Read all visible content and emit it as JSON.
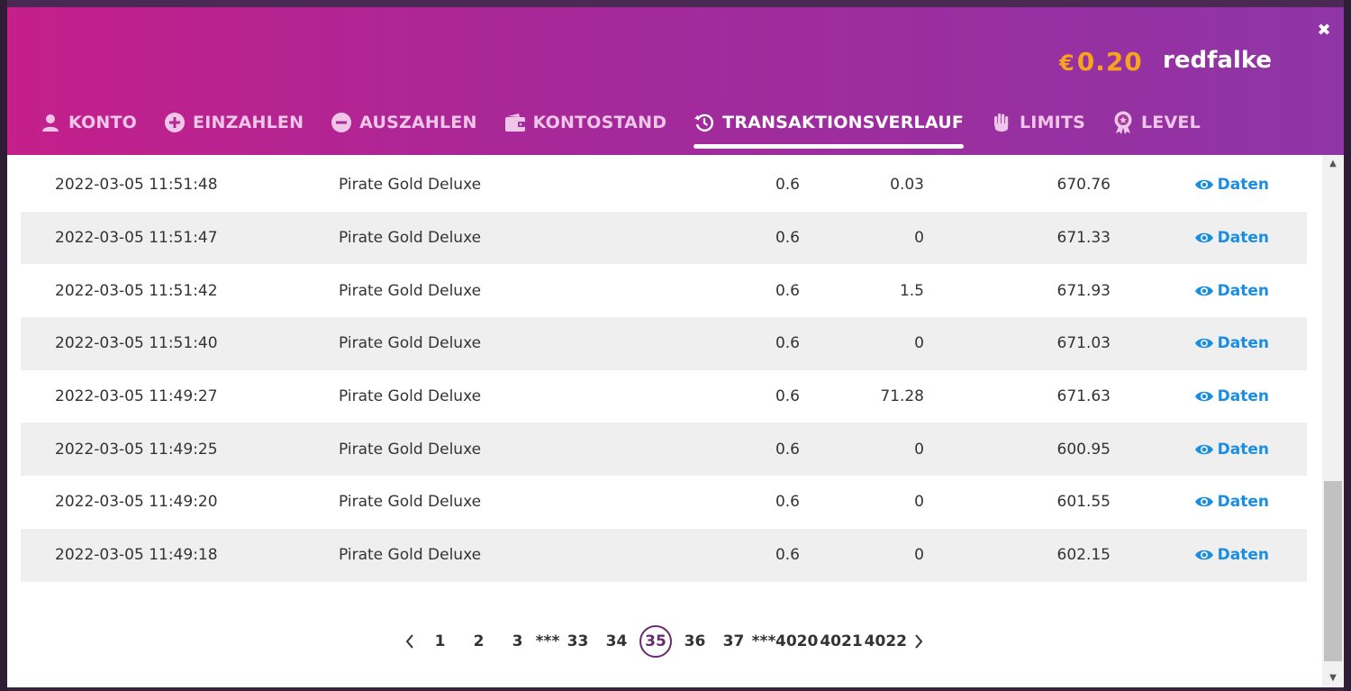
{
  "header": {
    "close_label": "✖",
    "balance_currency": "€",
    "balance_amount": "0.20",
    "username": "redfalke"
  },
  "tabs": [
    {
      "label": "KONTO",
      "icon": "user-icon",
      "active": false
    },
    {
      "label": "EINZAHLEN",
      "icon": "plus-circle-icon",
      "active": false
    },
    {
      "label": "AUSZAHLEN",
      "icon": "minus-circle-icon",
      "active": false
    },
    {
      "label": "KONTOSTAND",
      "icon": "wallet-icon",
      "active": false
    },
    {
      "label": "TRANSAKTIONSVERLAUF",
      "icon": "history-icon",
      "active": true
    },
    {
      "label": "LIMITS",
      "icon": "hand-icon",
      "active": false
    },
    {
      "label": "LEVEL",
      "icon": "badge-icon",
      "active": false
    }
  ],
  "transactions": [
    {
      "date": "2022-03-05 11:51:48",
      "game": "Pirate Gold Deluxe",
      "bet": "0.6",
      "win": "0.03",
      "balance": "670.76",
      "link": "Daten"
    },
    {
      "date": "2022-03-05 11:51:47",
      "game": "Pirate Gold Deluxe",
      "bet": "0.6",
      "win": "0",
      "balance": "671.33",
      "link": "Daten"
    },
    {
      "date": "2022-03-05 11:51:42",
      "game": "Pirate Gold Deluxe",
      "bet": "0.6",
      "win": "1.5",
      "balance": "671.93",
      "link": "Daten"
    },
    {
      "date": "2022-03-05 11:51:40",
      "game": "Pirate Gold Deluxe",
      "bet": "0.6",
      "win": "0",
      "balance": "671.03",
      "link": "Daten"
    },
    {
      "date": "2022-03-05 11:49:27",
      "game": "Pirate Gold Deluxe",
      "bet": "0.6",
      "win": "71.28",
      "balance": "671.63",
      "link": "Daten"
    },
    {
      "date": "2022-03-05 11:49:25",
      "game": "Pirate Gold Deluxe",
      "bet": "0.6",
      "win": "0",
      "balance": "600.95",
      "link": "Daten"
    },
    {
      "date": "2022-03-05 11:49:20",
      "game": "Pirate Gold Deluxe",
      "bet": "0.6",
      "win": "0",
      "balance": "601.55",
      "link": "Daten"
    },
    {
      "date": "2022-03-05 11:49:18",
      "game": "Pirate Gold Deluxe",
      "bet": "0.6",
      "win": "0",
      "balance": "602.15",
      "link": "Daten"
    }
  ],
  "pagination": {
    "prev": "‹",
    "next": "›",
    "ellipsis": "***",
    "pages": [
      "1",
      "2",
      "3",
      "33",
      "34",
      "35",
      "36",
      "37",
      "4020",
      "4021",
      "4022"
    ],
    "current": "35"
  },
  "colors": {
    "header_gradient_start": "#c41f8a",
    "header_gradient_end": "#8f35a6",
    "balance": "#f7a31c",
    "link": "#1a8ee0",
    "current_page": "#6a2a6e"
  }
}
